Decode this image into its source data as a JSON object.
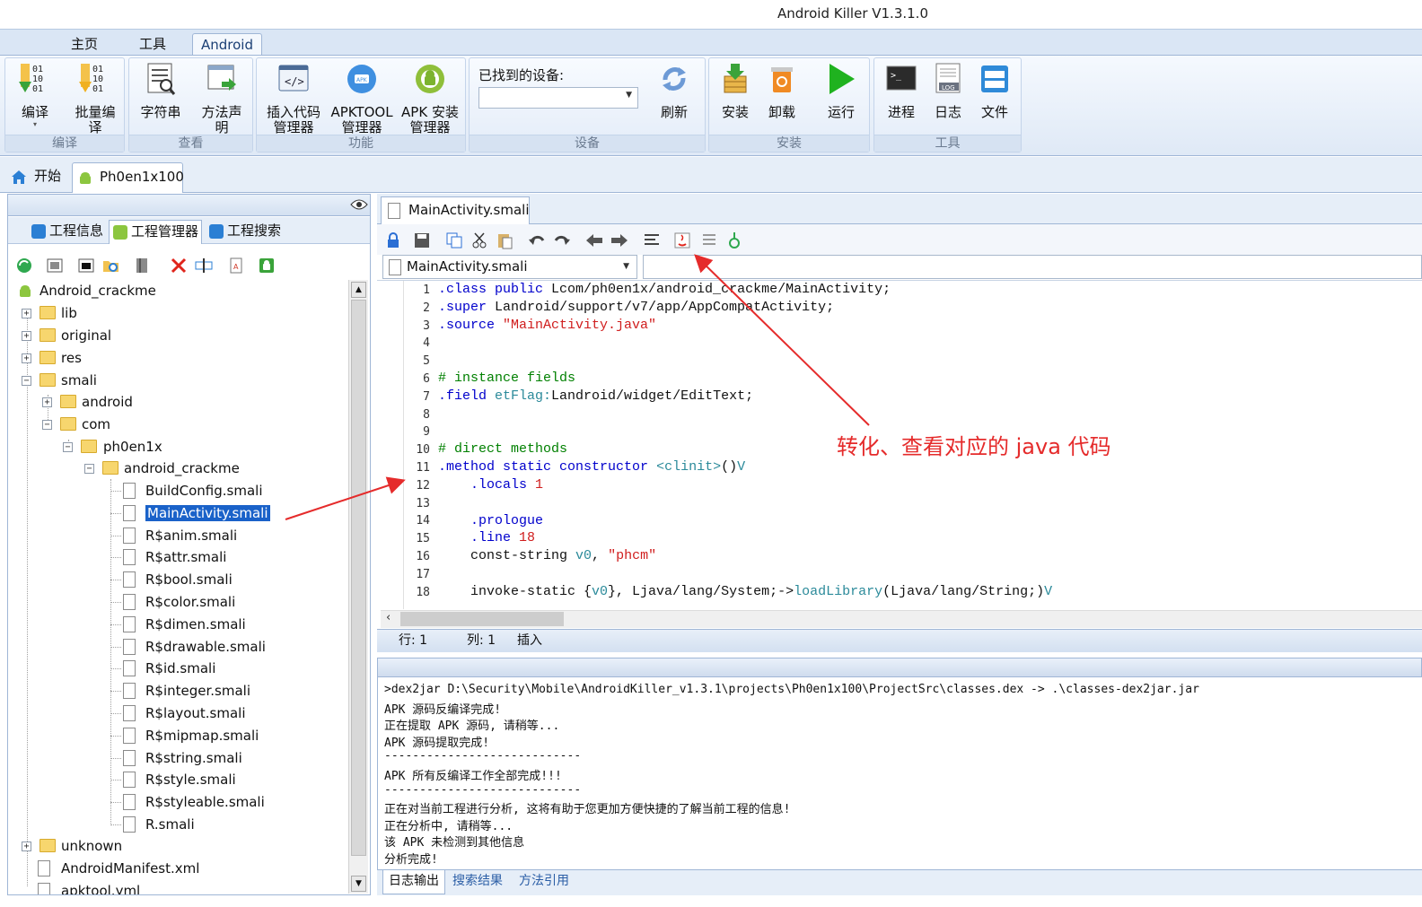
{
  "window": {
    "title": "Android Killer V1.3.1.0"
  },
  "ribbon": {
    "tabs": [
      "主页",
      "工具",
      "Android"
    ],
    "groups": {
      "compile": {
        "label": "编译",
        "buttons": [
          "编译",
          "批量编\n译"
        ]
      },
      "view": {
        "label": "查看",
        "buttons": [
          "字符串",
          "方法声\n明"
        ]
      },
      "function": {
        "label": "功能",
        "buttons": [
          "插入代码\n管理器",
          "APKTOOL\n管理器",
          "APK 安装\n管理器"
        ]
      },
      "device": {
        "label": "设备",
        "found_label": "已找到的设备:",
        "device_value": "",
        "refresh": "刷新"
      },
      "install": {
        "label": "安装",
        "buttons": [
          "安装",
          "卸载",
          "运行"
        ]
      },
      "tools": {
        "label": "工具",
        "buttons": [
          "进程",
          "日志",
          "文件"
        ]
      }
    }
  },
  "doc_tabs": [
    "开始",
    "Ph0en1x100"
  ],
  "left_panel": {
    "tabs": [
      "工程信息",
      "工程管理器",
      "工程搜索"
    ],
    "tree": [
      {
        "label": "Android_crackme",
        "type": "project"
      },
      {
        "label": "lib",
        "type": "folder"
      },
      {
        "label": "original",
        "type": "folder"
      },
      {
        "label": "res",
        "type": "folder"
      },
      {
        "label": "smali",
        "type": "folder"
      },
      {
        "label": "android",
        "type": "folder"
      },
      {
        "label": "com",
        "type": "folder"
      },
      {
        "label": "ph0en1x",
        "type": "folder"
      },
      {
        "label": "android_crackme",
        "type": "folder"
      },
      {
        "label": "BuildConfig.smali",
        "type": "file"
      },
      {
        "label": "MainActivity.smali",
        "type": "file",
        "selected": true
      },
      {
        "label": "R$anim.smali",
        "type": "file"
      },
      {
        "label": "R$attr.smali",
        "type": "file"
      },
      {
        "label": "R$bool.smali",
        "type": "file"
      },
      {
        "label": "R$color.smali",
        "type": "file"
      },
      {
        "label": "R$dimen.smali",
        "type": "file"
      },
      {
        "label": "R$drawable.smali",
        "type": "file"
      },
      {
        "label": "R$id.smali",
        "type": "file"
      },
      {
        "label": "R$integer.smali",
        "type": "file"
      },
      {
        "label": "R$layout.smali",
        "type": "file"
      },
      {
        "label": "R$mipmap.smali",
        "type": "file"
      },
      {
        "label": "R$string.smali",
        "type": "file"
      },
      {
        "label": "R$style.smali",
        "type": "file"
      },
      {
        "label": "R$styleable.smali",
        "type": "file"
      },
      {
        "label": "R.smali",
        "type": "file"
      },
      {
        "label": "unknown",
        "type": "folder"
      },
      {
        "label": "AndroidManifest.xml",
        "type": "xml"
      },
      {
        "label": "apktool.yml",
        "type": "xml"
      }
    ]
  },
  "editor": {
    "tab": "MainActivity.smali",
    "file_combo": "MainActivity.smali",
    "method_combo": "",
    "line_numbers": [
      "1",
      "2",
      "3",
      "4",
      "5",
      "6",
      "7",
      "8",
      "9",
      "10",
      "11",
      "12",
      "13",
      "14",
      "15",
      "16",
      "17",
      "18"
    ],
    "status": {
      "line": "行: 1",
      "col": "列: 1",
      "mode": "插入"
    }
  },
  "output": {
    "lines": [
      ">dex2jar D:\\Security\\Mobile\\AndroidKiller_v1.3.1\\projects\\Ph0en1x100\\ProjectSrc\\classes.dex -> .\\classes-dex2jar.jar",
      "APK 源码反编译完成!",
      "正在提取 APK 源码, 请稍等...",
      "APK 源码提取完成!",
      "----------------------------",
      "APK 所有反编译工作全部完成!!!",
      "----------------------------",
      "正在对当前工程进行分析, 这将有助于您更加方便快捷的了解当前工程的信息!",
      "正在分析中, 请稍等...",
      "该 APK 未检测到其他信息",
      "分析完成!"
    ],
    "tabs": [
      "日志输出",
      "搜索结果",
      "方法引用"
    ]
  },
  "annotation": {
    "text": "转化、查看对应的 java 代码",
    "color": "#e52b2b"
  },
  "colors": {
    "ribbon_bg": "#dae6f5",
    "selection": "#1a62c9",
    "keyword": "#0000cc",
    "string": "#d01d1d",
    "comment": "#008000"
  }
}
